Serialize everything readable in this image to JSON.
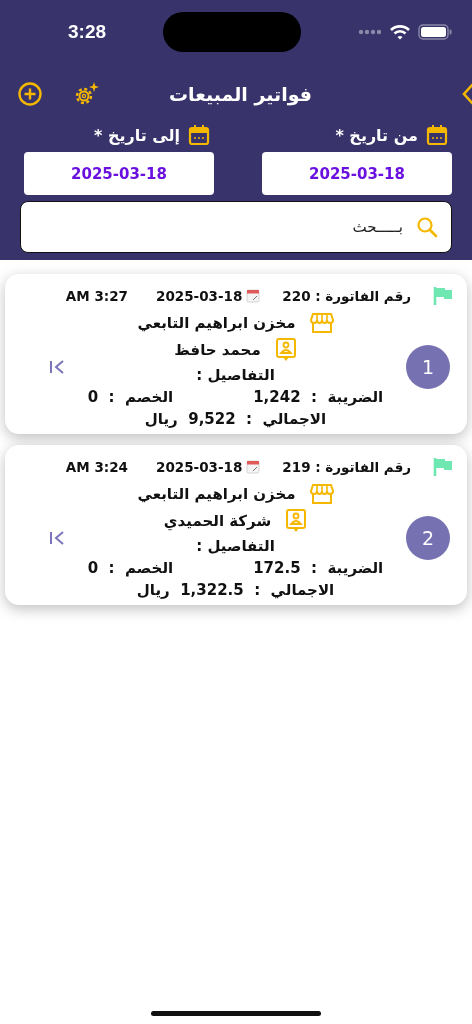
{
  "status_bar": {
    "time": "3:28"
  },
  "header": {
    "title": "فواتير المبيعات"
  },
  "filters": [
    {
      "label": "من تاريخ *",
      "value": "2025-03-18"
    },
    {
      "label": "إلى تاريخ *",
      "value": "2025-03-18"
    }
  ],
  "search": {
    "placeholder": "بـــــحث"
  },
  "invoices": [
    {
      "number": "1",
      "invoice_no": "رقم الفاتورة : 220",
      "date": "2025-03-18",
      "time": "AM 3:27",
      "store": "مخزن ابراهيم التابعي",
      "customer": "محمد حافظ",
      "details": "التفاصيل :",
      "tax": "الضريبة  :  1,242",
      "discount": "الخصم  :  0",
      "total": "الاجمالي  :  9,522  ريال"
    },
    {
      "number": "2",
      "invoice_no": "رقم الفاتورة : 219",
      "date": "2025-03-18",
      "time": "AM 3:24",
      "store": "مخزن ابراهيم التابعي",
      "customer": "شركة الحميدي",
      "details": "التفاصيل :",
      "tax": "الضريبة  :  172.5",
      "discount": "الخصم  :  0",
      "total": "الاجمالي  :  1,322.5  ريال"
    }
  ]
}
